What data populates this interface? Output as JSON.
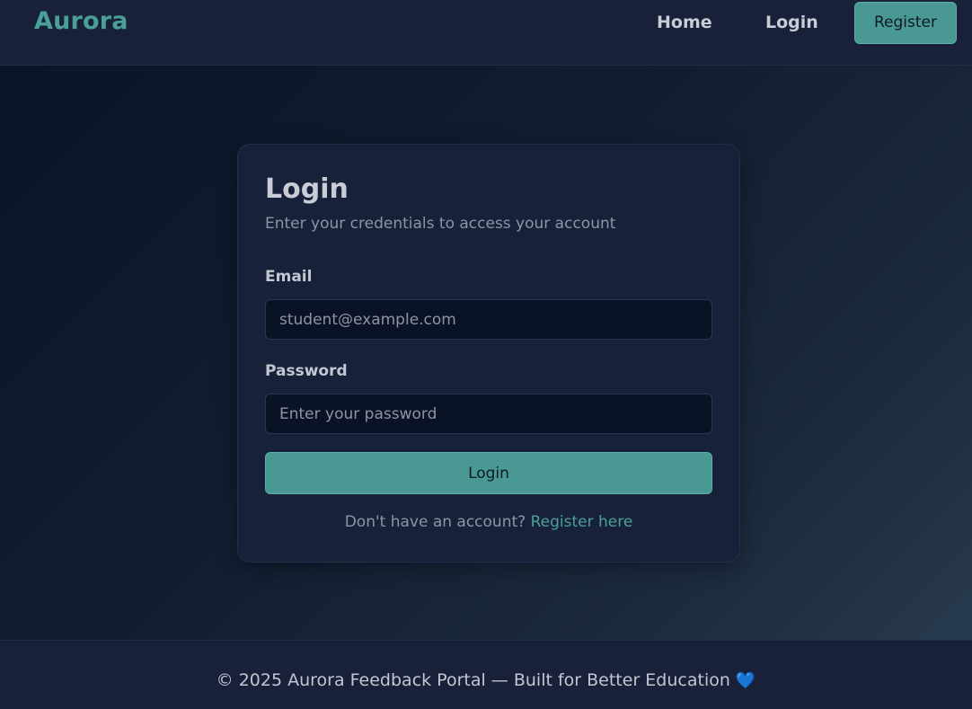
{
  "header": {
    "brand": "Aurora",
    "nav": {
      "home": "Home",
      "login": "Login",
      "register": "Register"
    }
  },
  "login_card": {
    "title": "Login",
    "subtitle": "Enter your credentials to access your account",
    "email": {
      "label": "Email",
      "value": "",
      "placeholder": "student@example.com"
    },
    "password": {
      "label": "Password",
      "value": "",
      "placeholder": "Enter your password"
    },
    "submit_label": "Login",
    "register_prompt": "Don't have an account?",
    "register_link": "Register here"
  },
  "footer": {
    "text": "© 2025 Aurora Feedback Portal — Built for Better Education",
    "heart_icon": "blue-heart-icon",
    "heart_glyph": "💙"
  },
  "colors": {
    "accent": "#4a9894",
    "brand_text": "#4aa099",
    "navbar_bg": "#18203a",
    "card_bg": "#18213a",
    "input_bg": "#0a1226",
    "heart": "#3a6fd8"
  }
}
